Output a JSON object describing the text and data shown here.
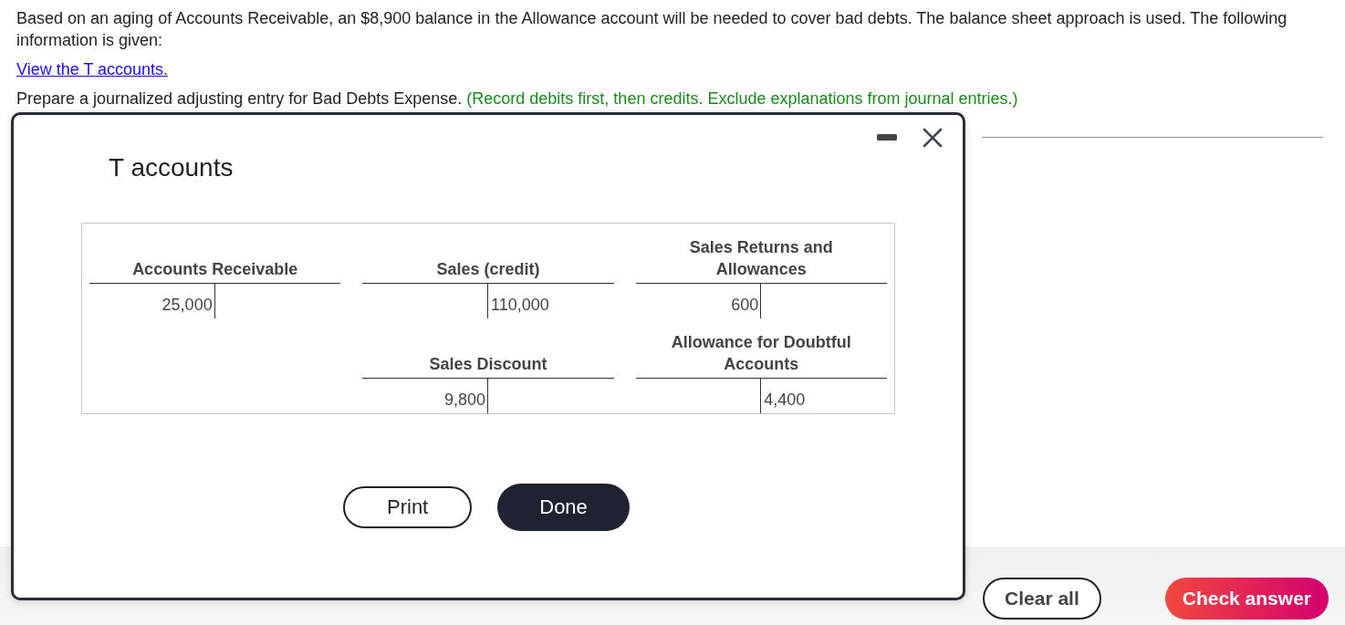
{
  "question": {
    "intro": "Based on an aging of Accounts Receivable, an $8,900 balance in the Allowance account will be needed to cover bad debts. The balance sheet approach is used. The following information is given:",
    "link": "View the T accounts.",
    "instruction": "Prepare a journalized adjusting entry for Bad Debts Expense.",
    "hint": "(Record debits first, then credits. Exclude explanations from journal entries.)"
  },
  "dialog": {
    "title": "T accounts",
    "rows": [
      {
        "cells": [
          {
            "kind": "account",
            "name": "Accounts Receivable",
            "debit": "25,000"
          },
          {
            "kind": "account",
            "name": "Sales (credit)",
            "credit": "110,000"
          },
          {
            "kind": "account",
            "name": "Sales Returns and Allowances",
            "debit": "600"
          }
        ]
      },
      {
        "cells": [
          {
            "kind": "blank"
          },
          {
            "kind": "account",
            "name": "Sales Discount",
            "debit": "9,800"
          },
          {
            "kind": "account",
            "name": "Allowance for Doubtful Accounts",
            "credit": "4,400"
          }
        ]
      }
    ],
    "buttons": [
      {
        "label": "Print",
        "kind": "outline"
      },
      {
        "label": "Done",
        "kind": "solid"
      }
    ]
  },
  "footer": {
    "buttons": [
      {
        "label": "Clear all",
        "kind": "outline"
      },
      {
        "label": "Check answer",
        "kind": "gradient"
      }
    ]
  }
}
